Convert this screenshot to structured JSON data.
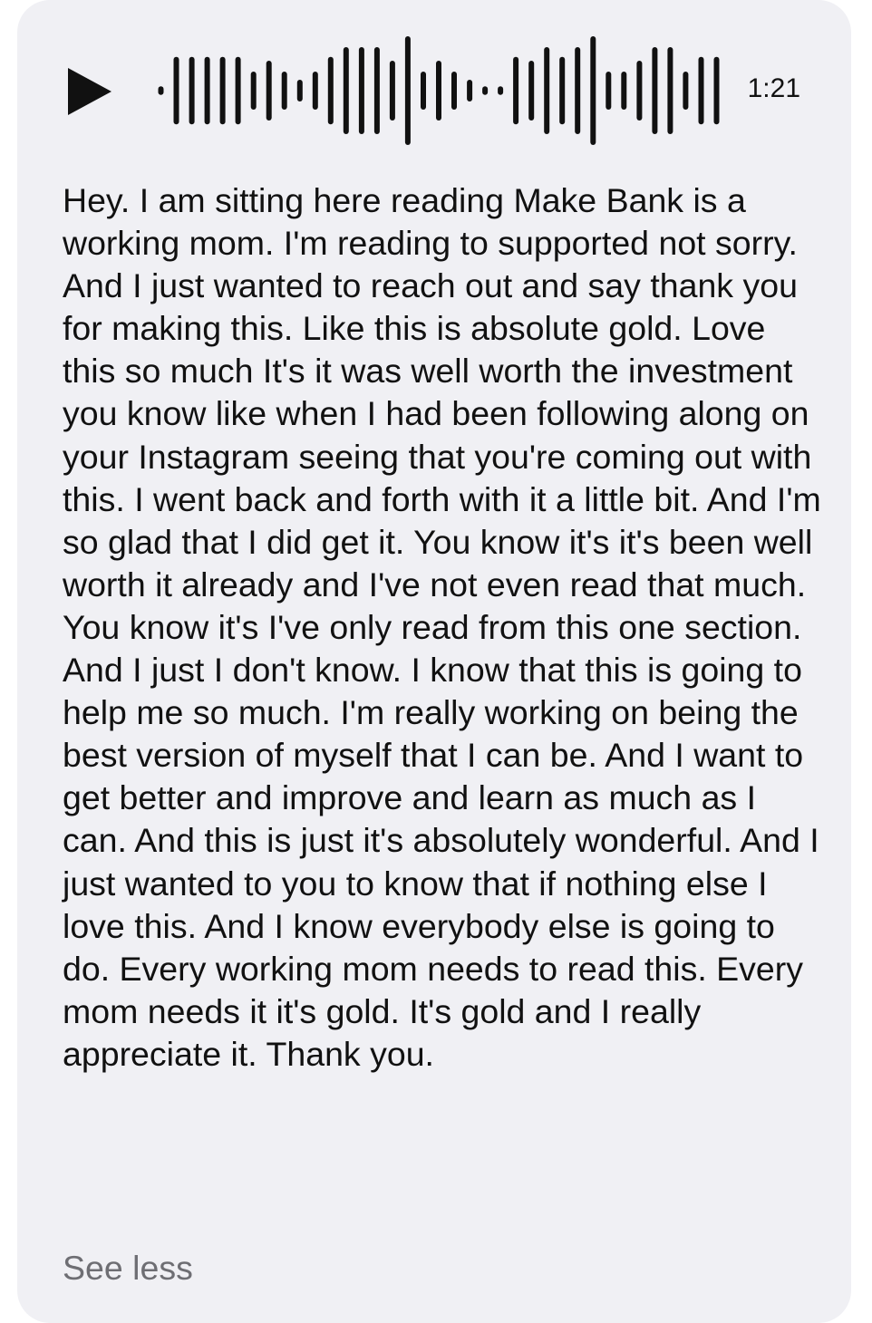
{
  "audio_message": {
    "play_icon": "play-triangle-icon",
    "duration": "1:21",
    "waveform_levels": [
      0.08,
      0.62,
      0.62,
      0.62,
      0.62,
      0.62,
      0.35,
      0.55,
      0.35,
      0.2,
      0.35,
      0.62,
      0.8,
      0.8,
      0.8,
      0.55,
      1.0,
      0.35,
      0.55,
      0.35,
      0.2,
      0.08,
      0.08,
      0.62,
      0.55,
      0.8,
      0.62,
      0.8,
      1.0,
      0.35,
      0.35,
      0.55,
      0.8,
      0.8,
      0.35,
      0.62,
      0.62
    ]
  },
  "transcript": {
    "text": "Hey. I am sitting here reading Make Bank is a working mom. I'm reading to supported not sorry. And I just wanted to reach out and say thank you for making this. Like this is absolute gold. Love this so much It's it was well worth the investment you know like when I had been following along on your Instagram seeing that you're coming out with this. I went back and forth with it a little bit. And I'm so glad that I did get it. You know it's it's been well worth it already and I've not even read that much. You know it's I've only read from this one section. And I just I don't know. I know that this is going to help me so much. I'm really working on being the best version of myself that I can be. And I want to get better and improve and learn as much as I can. And this is just it's absolutely wonderful. And I just wanted to you to know that if nothing else I love this. And I know everybody else is going to do. Every working mom needs to read this. Every mom needs it it's gold. It's gold and I really appreciate it. Thank you.",
    "toggle_label": "See less"
  },
  "colors": {
    "bubble": "#f0f0f4",
    "text": "#111111",
    "secondary_text": "#6e6e73"
  }
}
